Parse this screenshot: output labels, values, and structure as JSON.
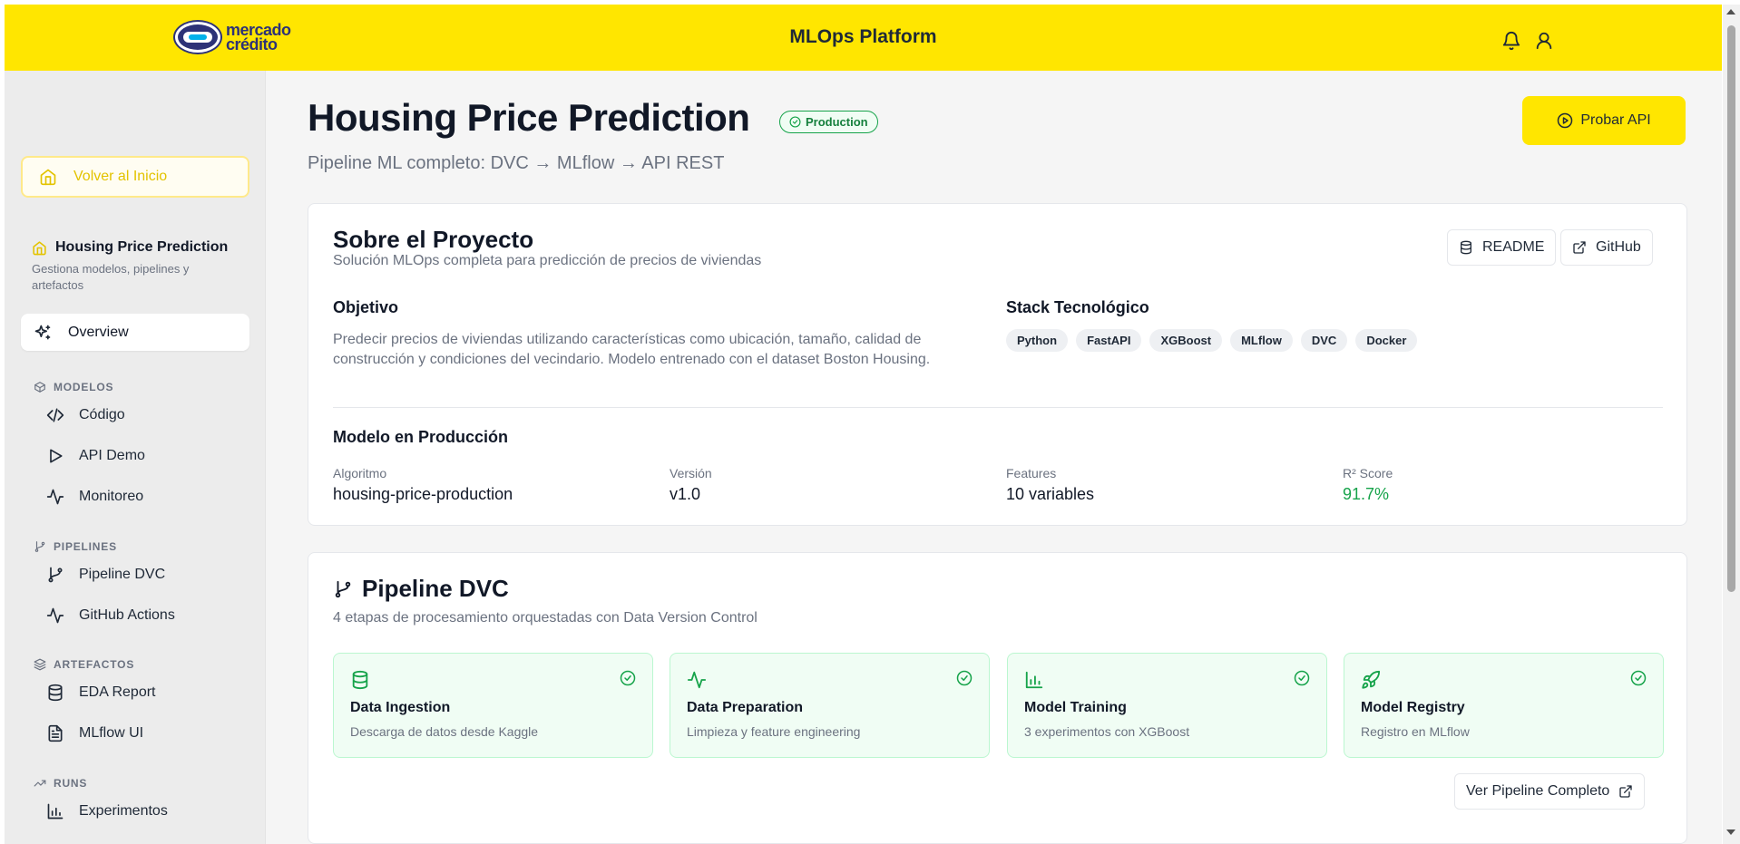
{
  "header": {
    "logo_line1": "mercado",
    "logo_line2": "crédito",
    "app_title": "MLOps Platform",
    "icons": [
      "bell-icon",
      "user-icon"
    ],
    "accent": "#ffe600"
  },
  "sidebar": {
    "back_label": "Volver al Inicio",
    "project_title": "Housing Price Prediction",
    "project_subtitle": "Gestiona modelos, pipelines y artefactos",
    "overview_label": "Overview",
    "sections": {
      "modelos": "MODELOS",
      "pipelines": "PIPELINES",
      "artefactos": "ARTEFACTOS",
      "runs": "RUNS"
    },
    "items": {
      "codigo": "Código",
      "api_demo": "API Demo",
      "monitoreo": "Monitoreo",
      "pipeline_dvc": "Pipeline DVC",
      "github_actions": "GitHub Actions",
      "eda_report": "EDA Report",
      "mlflow_ui": "MLflow UI",
      "experimentos": "Experimentos"
    }
  },
  "page": {
    "title": "Housing Price Prediction",
    "badge": "Production",
    "subtitle": "Pipeline ML completo: DVC → MLflow → API REST",
    "probar_api": "Probar API"
  },
  "about": {
    "title": "Sobre el Proyecto",
    "subtitle": "Solución MLOps completa para predicción de precios de viviendas",
    "readme": "README",
    "github": "GitHub",
    "objetivo_title": "Objetivo",
    "objetivo_text": "Predecir precios de viviendas utilizando características como ubicación, tamaño, calidad de construcción y condiciones del vecindario. Modelo entrenado con el dataset Boston Housing.",
    "stack_title": "Stack Tecnológico",
    "stack": [
      "Python",
      "FastAPI",
      "XGBoost",
      "MLflow",
      "DVC",
      "Docker"
    ],
    "model_title": "Modelo en Producción",
    "metrics": [
      {
        "label": "Algoritmo",
        "value": "housing-price-production"
      },
      {
        "label": "Versión",
        "value": "v1.0"
      },
      {
        "label": "Features",
        "value": "10 variables"
      },
      {
        "label": "R² Score",
        "value": "91.7%"
      }
    ]
  },
  "pipeline": {
    "title": "Pipeline DVC",
    "subtitle": "4 etapas de procesamiento orquestadas con Data Version Control",
    "stages": [
      {
        "title": "Data Ingestion",
        "desc": "Descarga de datos desde Kaggle",
        "icon": "database-icon"
      },
      {
        "title": "Data Preparation",
        "desc": "Limpieza y feature engineering",
        "icon": "activity-icon"
      },
      {
        "title": "Model Training",
        "desc": "3 experimentos con XGBoost",
        "icon": "bar-chart-icon"
      },
      {
        "title": "Model Registry",
        "desc": "Registro en MLflow",
        "icon": "rocket-icon"
      }
    ],
    "cta": "Ver Pipeline Completo"
  }
}
